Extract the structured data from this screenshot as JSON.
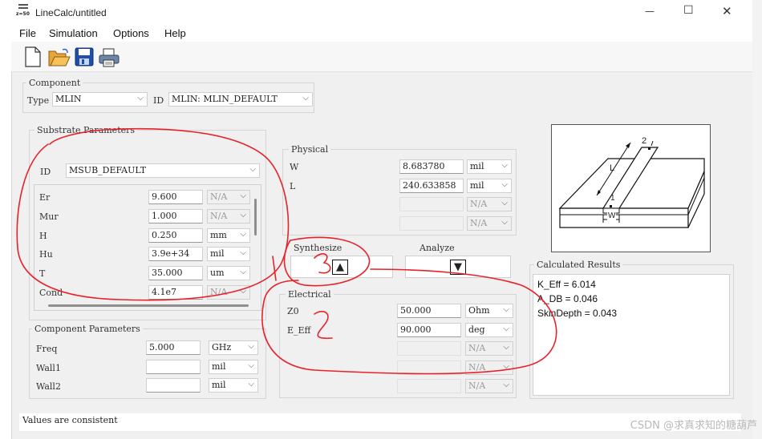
{
  "window": {
    "title": "LineCalc/untitled",
    "app_icon_caption": "z=50",
    "controls": {
      "minimize": "—",
      "maximize": "☐",
      "close": "✕"
    }
  },
  "menu": [
    "File",
    "Simulation",
    "Options",
    "Help"
  ],
  "toolbar": [
    "new-document-icon",
    "open-folder-icon",
    "save-disk-icon",
    "print-icon"
  ],
  "component": {
    "group_title": "Component",
    "type_label": "Type",
    "type_value": "MLIN",
    "id_label": "ID",
    "id_value": "MLIN: MLIN_DEFAULT"
  },
  "substrate": {
    "group_title": "Substrate Parameters",
    "id_label": "ID",
    "id_value": "MSUB_DEFAULT",
    "rows": [
      {
        "name": "Er",
        "value": "9.600",
        "unit": "N/A",
        "unit_enabled": false
      },
      {
        "name": "Mur",
        "value": "1.000",
        "unit": "N/A",
        "unit_enabled": false
      },
      {
        "name": "H",
        "value": "0.250",
        "unit": "mm",
        "unit_enabled": true
      },
      {
        "name": "Hu",
        "value": "3.9e+34",
        "unit": "mil",
        "unit_enabled": true
      },
      {
        "name": "T",
        "value": "35.000",
        "unit": "um",
        "unit_enabled": true
      },
      {
        "name": "Cond",
        "value": "4.1e7",
        "unit": "N/A",
        "unit_enabled": false
      }
    ]
  },
  "component_params": {
    "group_title": "Component Parameters",
    "rows": [
      {
        "name": "Freq",
        "value": "5.000",
        "unit": "GHz"
      },
      {
        "name": "Wall1",
        "value": "",
        "unit": "mil"
      },
      {
        "name": "Wall2",
        "value": "",
        "unit": "mil"
      }
    ]
  },
  "physical": {
    "group_title": "Physical",
    "rows": [
      {
        "name": "W",
        "value": "8.683780",
        "unit": "mil",
        "enabled": true
      },
      {
        "name": "L",
        "value": "240.633858",
        "unit": "mil",
        "enabled": true
      },
      {
        "name": "",
        "value": "",
        "unit": "N/A",
        "enabled": false
      },
      {
        "name": "",
        "value": "",
        "unit": "N/A",
        "enabled": false
      }
    ]
  },
  "synthesize": {
    "label": "Synthesize",
    "arrow": "▲"
  },
  "analyze": {
    "label": "Analyze",
    "arrow": "▼"
  },
  "electrical": {
    "group_title": "Electrical",
    "rows": [
      {
        "name": "Z0",
        "value": "50.000",
        "unit": "Ohm",
        "enabled": true
      },
      {
        "name": "E_Eff",
        "value": "90.000",
        "unit": "deg",
        "enabled": true
      },
      {
        "name": "",
        "value": "",
        "unit": "N/A",
        "enabled": false
      },
      {
        "name": "",
        "value": "",
        "unit": "N/A",
        "enabled": false
      },
      {
        "name": "",
        "value": "",
        "unit": "N/A",
        "enabled": false
      }
    ]
  },
  "diagram_labels": {
    "top": "2",
    "bottom": "1",
    "length": "L",
    "width": "W"
  },
  "results": {
    "title": "Calculated Results",
    "lines": [
      "K_Eff = 6.014",
      "A_DB = 0.046",
      "SkinDepth = 0.043"
    ]
  },
  "annotations": {
    "one": "1",
    "three": "3",
    "two": "2",
    "color": "#e8222a"
  },
  "status": "Values are consistent",
  "watermark": "CSDN @求真求知的糖葫芦"
}
